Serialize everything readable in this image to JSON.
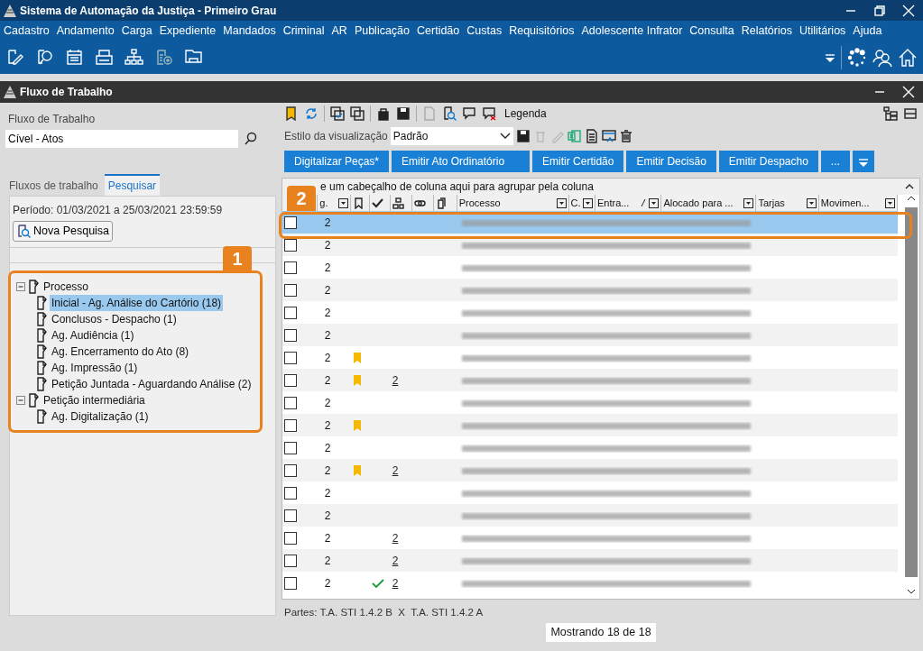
{
  "app_window": {
    "title": "Sistema de Automação da Justiça - Primeiro Grau"
  },
  "menu": [
    "Cadastro",
    "Andamento",
    "Carga",
    "Expediente",
    "Mandados",
    "Criminal",
    "AR",
    "Publicação",
    "Certidão",
    "Custas",
    "Requisitórios",
    "Adolescente Infrator",
    "Consulta",
    "Relatórios",
    "Utilitários",
    "Ajuda"
  ],
  "subwindow": {
    "title": "Fluxo de Trabalho"
  },
  "left_panel": {
    "field_label": "Fluxo de Trabalho",
    "field_value": "Cível - Atos",
    "tabs": [
      {
        "label": "Fluxos de trabalho",
        "selected": false
      },
      {
        "label": "Pesquisar",
        "selected": true
      }
    ],
    "period": "Período: 01/03/2021 a 25/03/2021 23:59:59",
    "new_search_button": "Nova Pesquisa",
    "tree": [
      {
        "label": "Processo",
        "selected": false,
        "expanded": true,
        "children": [
          {
            "label": "Inicial - Ag. Análise do Cartório (18)",
            "selected": true
          },
          {
            "label": "Conclusos - Despacho (1)",
            "selected": false
          },
          {
            "label": "Ag. Audiência (1)",
            "selected": false
          },
          {
            "label": "Ag. Encerramento do Ato (8)",
            "selected": false
          },
          {
            "label": "Ag. Impressão (1)",
            "selected": false
          },
          {
            "label": "Petição Juntada - Aguardando Análise (2)",
            "selected": false
          }
        ]
      },
      {
        "label": "Petição intermediária",
        "selected": false,
        "expanded": true,
        "children": [
          {
            "label": "Ag. Digitalização (1)",
            "selected": false
          }
        ]
      }
    ]
  },
  "right_panel": {
    "legend": "Legenda",
    "style_label": "Estilo da visualização",
    "style_value": "Padrão",
    "action_buttons": [
      "Digitalizar Peças*",
      "Emitir Ato Ordinatório",
      "Emitir Certidão",
      "Emitir Decisão",
      "Emitir Despacho",
      "..."
    ],
    "group_hint": "e um cabeçalho de coluna aqui para agrupar pela coluna",
    "columns": [
      "g.",
      "Processo",
      "C.",
      "Entra...",
      "Alocado para ...",
      "Tarjas",
      "Movimen..."
    ],
    "rows": [
      {
        "selected": true,
        "checked": false,
        "count": "2",
        "flagged": false,
        "done": false
      },
      {
        "selected": false,
        "checked": false,
        "count": "2",
        "flagged": false,
        "done": false
      },
      {
        "selected": false,
        "checked": false,
        "count": "2",
        "flagged": false,
        "done": false
      },
      {
        "selected": false,
        "checked": false,
        "count": "2",
        "flagged": false,
        "done": false
      },
      {
        "selected": false,
        "checked": false,
        "count": "2",
        "flagged": false,
        "done": false
      },
      {
        "selected": false,
        "checked": false,
        "count": "2",
        "flagged": false,
        "done": false
      },
      {
        "selected": false,
        "checked": false,
        "count": "2",
        "flagged": true,
        "done": false
      },
      {
        "selected": false,
        "checked": false,
        "count": "2",
        "flagged": true,
        "done": false,
        "link": "2"
      },
      {
        "selected": false,
        "checked": false,
        "count": "2",
        "flagged": false,
        "done": false
      },
      {
        "selected": false,
        "checked": false,
        "count": "2",
        "flagged": true,
        "done": false
      },
      {
        "selected": false,
        "checked": false,
        "count": "2",
        "flagged": false,
        "done": false
      },
      {
        "selected": false,
        "checked": false,
        "count": "2",
        "flagged": true,
        "done": false,
        "link": "2"
      },
      {
        "selected": false,
        "checked": false,
        "count": "2",
        "flagged": false,
        "done": false
      },
      {
        "selected": false,
        "checked": false,
        "count": "2",
        "flagged": false,
        "done": false
      },
      {
        "selected": false,
        "checked": false,
        "count": "2",
        "flagged": false,
        "done": false,
        "link": "2"
      },
      {
        "selected": false,
        "checked": false,
        "count": "2",
        "flagged": false,
        "done": false,
        "link": "2"
      },
      {
        "selected": false,
        "checked": false,
        "count": "2",
        "flagged": false,
        "done": true,
        "link": "2"
      }
    ],
    "parties": "Partes: T.A. STI 1.4.2 B  X  T.A. STI 1.4.2 A",
    "status": "Mostrando 18 de 18"
  },
  "annotations": [
    {
      "label": "1"
    },
    {
      "label": "2"
    }
  ]
}
